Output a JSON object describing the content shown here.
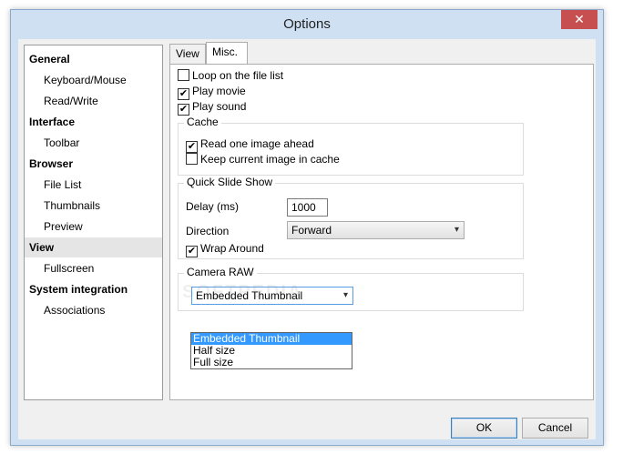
{
  "window": {
    "title": "Options",
    "close_glyph": "✕"
  },
  "nav": {
    "items": [
      {
        "label": "General",
        "level": "category"
      },
      {
        "label": "Keyboard/Mouse",
        "level": "sub"
      },
      {
        "label": "Read/Write",
        "level": "sub"
      },
      {
        "label": "Interface",
        "level": "category"
      },
      {
        "label": "Toolbar",
        "level": "sub"
      },
      {
        "label": "Browser",
        "level": "category"
      },
      {
        "label": "File List",
        "level": "sub"
      },
      {
        "label": "Thumbnails",
        "level": "sub"
      },
      {
        "label": "Preview",
        "level": "sub"
      },
      {
        "label": "View",
        "level": "category",
        "selected": true
      },
      {
        "label": "Fullscreen",
        "level": "sub"
      },
      {
        "label": "System integration",
        "level": "category"
      },
      {
        "label": "Associations",
        "level": "sub"
      }
    ]
  },
  "tabs": [
    {
      "label": "View",
      "active": false
    },
    {
      "label": "Misc.",
      "active": true
    }
  ],
  "misc": {
    "loop": {
      "label": "Loop on the file list",
      "checked": false
    },
    "play_movie": {
      "label": "Play movie",
      "checked": true
    },
    "play_sound": {
      "label": "Play sound",
      "checked": true
    },
    "cache": {
      "title": "Cache",
      "read_ahead": {
        "label": "Read one image ahead",
        "checked": true
      },
      "keep_current": {
        "label": "Keep current image in cache",
        "checked": false
      }
    },
    "slideshow": {
      "title": "Quick Slide Show",
      "delay_label": "Delay (ms)",
      "delay_value": "1000",
      "direction_label": "Direction",
      "direction_value": "Forward",
      "wrap": {
        "label": "Wrap Around",
        "checked": true
      }
    },
    "camera_raw": {
      "title": "Camera RAW",
      "selected": "Embedded Thumbnail",
      "options": [
        "Embedded Thumbnail",
        "Half size",
        "Full size"
      ]
    }
  },
  "watermark": "SOFTPEDIA",
  "buttons": {
    "ok": "OK",
    "cancel": "Cancel"
  },
  "glyphs": {
    "check": "✔",
    "dropdown_arrow": "▾"
  },
  "colors": {
    "selection": "#3399ff",
    "nav_selected": "#e5e5e5",
    "close": "#c74f4f"
  }
}
